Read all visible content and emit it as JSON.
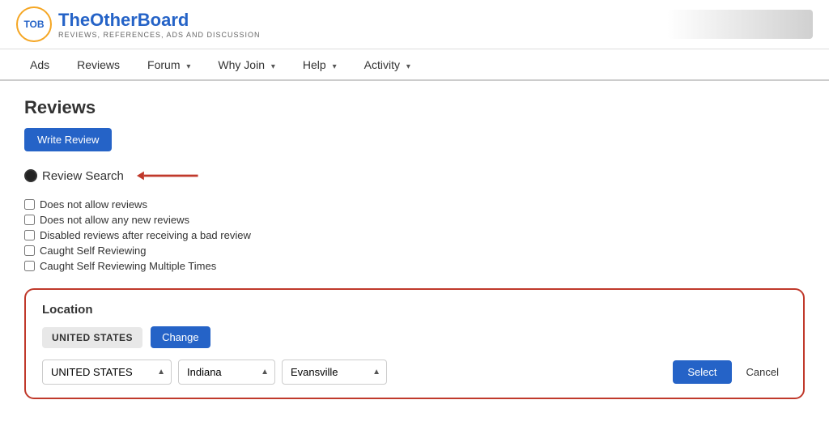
{
  "logo": {
    "abbr": "TOB",
    "name_prefix": "The",
    "name_suffix": "OtherBoard",
    "tagline": "REVIEWS, REFERENCES, ADS AND DISCUSSION"
  },
  "nav": {
    "items": [
      {
        "id": "ads",
        "label": "Ads",
        "has_dropdown": false
      },
      {
        "id": "reviews",
        "label": "Reviews",
        "has_dropdown": false
      },
      {
        "id": "forum",
        "label": "Forum",
        "has_dropdown": true
      },
      {
        "id": "why-join",
        "label": "Why Join",
        "has_dropdown": true
      },
      {
        "id": "help",
        "label": "Help",
        "has_dropdown": true
      },
      {
        "id": "activity",
        "label": "Activity",
        "has_dropdown": true
      }
    ]
  },
  "page": {
    "title": "Reviews",
    "write_review_label": "Write Review"
  },
  "review_search": {
    "label": "Review Search",
    "checkboxes": [
      "Does not allow reviews",
      "Does not allow any new reviews",
      "Disabled reviews after receiving a bad review",
      "Caught Self Reviewing",
      "Caught Self Reviewing Multiple Times"
    ]
  },
  "location": {
    "title": "Location",
    "country_badge": "UNITED STATES",
    "change_label": "Change",
    "country_options": [
      "UNITED STATES"
    ],
    "country_selected": "UNITED STATES",
    "state_options": [
      "Indiana"
    ],
    "state_selected": "Indiana",
    "city_options": [
      "Evansville"
    ],
    "city_selected": "Evansville",
    "select_label": "Select",
    "cancel_label": "Cancel"
  },
  "colors": {
    "primary": "#2563c7",
    "border_accent": "#c0392b",
    "arrow_color": "#c0392b"
  }
}
